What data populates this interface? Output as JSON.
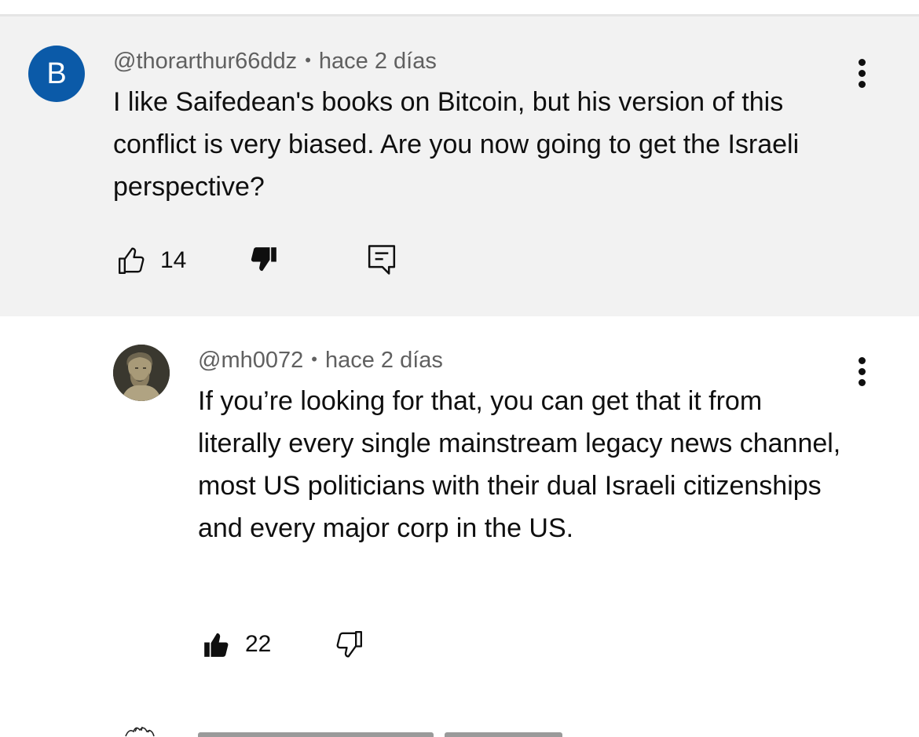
{
  "comments": [
    {
      "avatar_letter": "B",
      "avatar_color": "#0b5aa8",
      "author": "@thorarthur66ddz",
      "separator": "•",
      "time": "hace 2 días",
      "text": "I like Saifedean's books on Bitcoin, but his version of this conflict is very biased. Are you now going to get the Israeli perspective?",
      "likes": "14",
      "disliked": true,
      "icons": {
        "like": "thumbs-up-outline-icon",
        "dislike": "thumbs-down-filled-icon",
        "reply": "reply-comment-icon",
        "menu": "more-vertical-icon"
      }
    },
    {
      "avatar": "bust-statue-avatar",
      "author": "@mh0072",
      "separator": "•",
      "time": "hace 2 días",
      "text": "If you’re looking for that, you can get that it from literally every single mainstream legacy news channel, most US politicians with their dual Israeli citizenships and every major corp in the US.",
      "likes": "22",
      "liked": true,
      "icons": {
        "like": "thumbs-up-filled-icon",
        "dislike": "thumbs-down-outline-icon",
        "menu": "more-vertical-icon"
      }
    }
  ],
  "colors": {
    "highlight_bg": "#f2f2f2",
    "meta_text": "#606060",
    "text": "#0f0f0f"
  }
}
